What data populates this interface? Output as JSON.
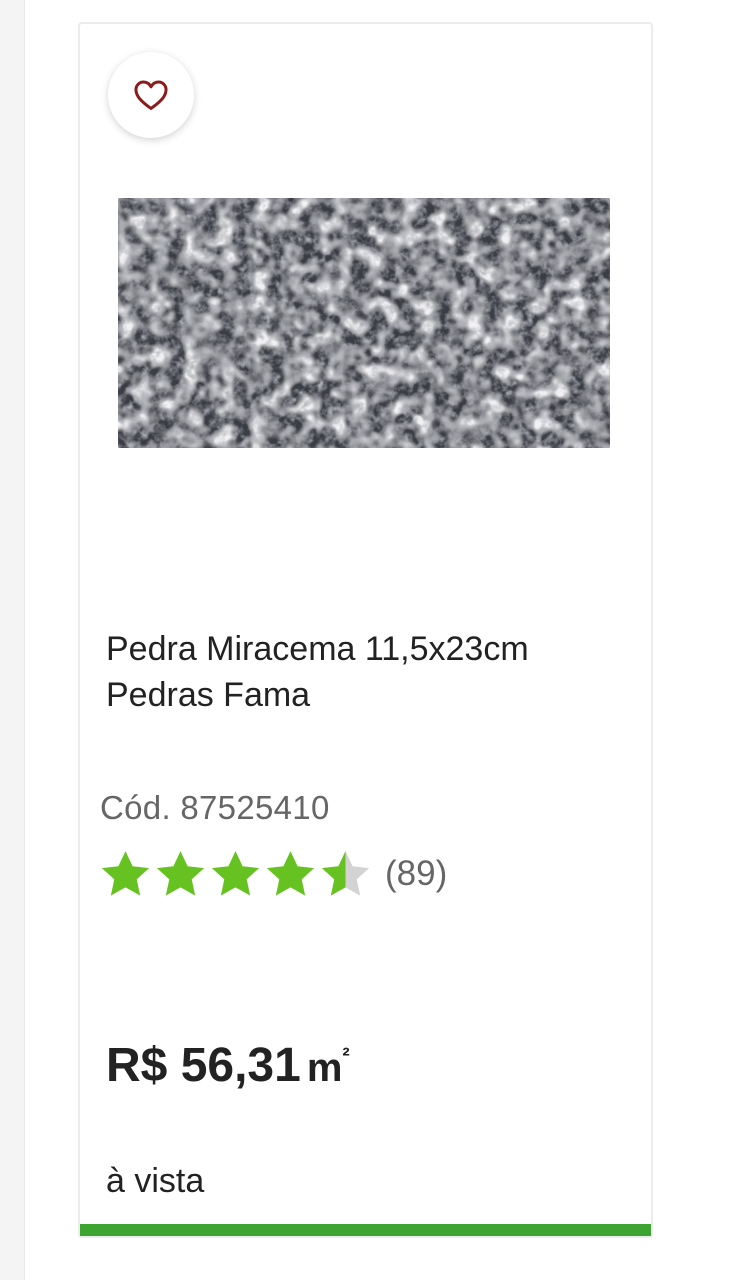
{
  "product": {
    "name": "Pedra Miracema 11,5x23cm Pedras Fama",
    "code": "Cód. 87525410",
    "rating": {
      "value": 4.5,
      "max": 5,
      "count_label": "(89)"
    },
    "price": {
      "amount": "R$ 56,31",
      "unit": "m",
      "unit_exp": "²"
    },
    "payment_label": "à vista"
  },
  "icons": {
    "favorite": "heart-outline-icon",
    "star": "star-icon"
  },
  "colors": {
    "heart": "#8a1c1c",
    "star_filled": "#66c221",
    "star_empty": "#d3d3d3",
    "accent_bar": "#3ea431",
    "text_primary": "#222222",
    "text_secondary": "#666666"
  }
}
